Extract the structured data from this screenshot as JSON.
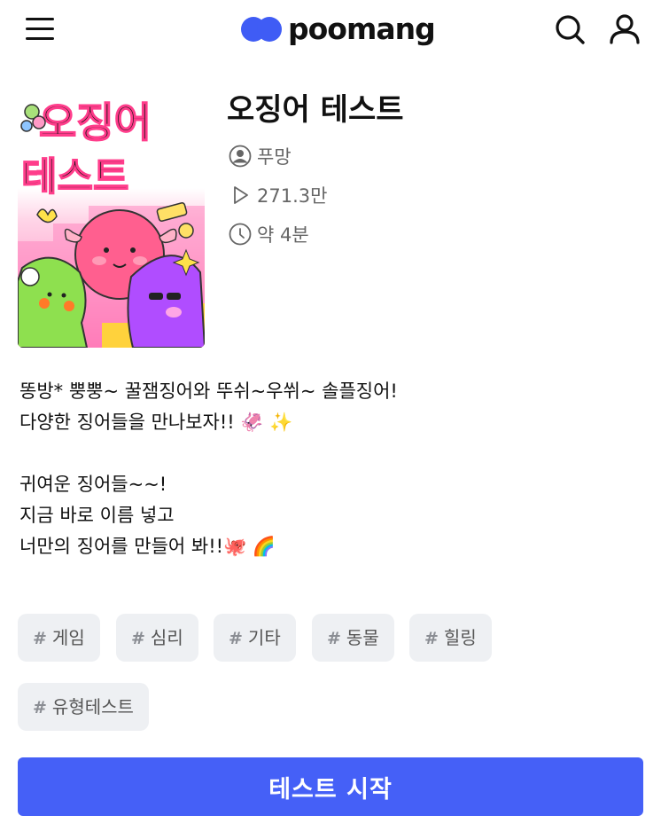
{
  "header": {
    "logo_text": "poomang",
    "colors": {
      "brand": "#3f5cf5"
    },
    "icons": [
      "menu-icon",
      "search-icon",
      "user-icon"
    ]
  },
  "test": {
    "title": "오징어 테스트",
    "author": "푸망",
    "plays": "271.3만",
    "duration": "약 4분",
    "thumbnail_text": [
      "오징어",
      "테스트"
    ],
    "description": [
      "똥방* 뿡뿡~ 꿀잼징어와 뚜쉬~우쒸~ 솔플징어!",
      "다양한 징어들을 만나보자!! 🦑 ✨",
      "",
      "귀여운 징어들~~!",
      "지금 바로 이름 넣고",
      "너만의 징어를 만들어 봐!!🐙 🌈"
    ]
  },
  "tags": [
    "게임",
    "심리",
    "기타",
    "동물",
    "힐링",
    "유형테스트"
  ],
  "tag_prefix": "#",
  "start_button": {
    "label": "테스트 시작",
    "color": "#4560f7"
  }
}
